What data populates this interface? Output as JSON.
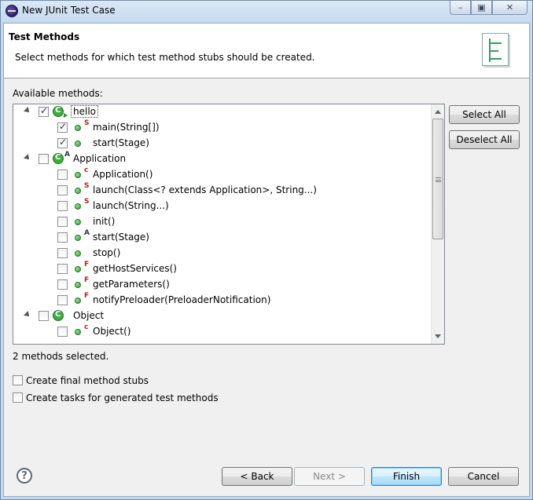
{
  "window": {
    "title": "New JUnit Test Case"
  },
  "header": {
    "title": "Test Methods",
    "description": "Select methods for which test method stubs should be created."
  },
  "available_label": "Available methods:",
  "tree": [
    {
      "label": "hello",
      "kind": "class",
      "checked": true,
      "run_badge": true
    },
    {
      "label": "main(String[])",
      "kind": "method",
      "modifier": "S",
      "checked": true
    },
    {
      "label": "start(Stage)",
      "kind": "method",
      "modifier": "",
      "checked": true
    },
    {
      "label": "Application",
      "kind": "class",
      "modifier": "A",
      "checked": false
    },
    {
      "label": "Application()",
      "kind": "method",
      "modifier": "c",
      "checked": false
    },
    {
      "label": "launch(Class<? extends Application>, String...)",
      "kind": "method",
      "modifier": "S",
      "checked": false
    },
    {
      "label": "launch(String...)",
      "kind": "method",
      "modifier": "S",
      "checked": false
    },
    {
      "label": "init()",
      "kind": "method",
      "modifier": "",
      "checked": false
    },
    {
      "label": "start(Stage)",
      "kind": "method",
      "modifier": "A",
      "checked": false
    },
    {
      "label": "stop()",
      "kind": "method",
      "modifier": "",
      "checked": false
    },
    {
      "label": "getHostServices()",
      "kind": "method",
      "modifier": "F",
      "checked": false
    },
    {
      "label": "getParameters()",
      "kind": "method",
      "modifier": "F",
      "checked": false
    },
    {
      "label": "notifyPreloader(PreloaderNotification)",
      "kind": "method",
      "modifier": "F",
      "checked": false
    },
    {
      "label": "Object",
      "kind": "class",
      "modifier": "",
      "checked": false
    },
    {
      "label": "Object()",
      "kind": "method",
      "modifier": "c",
      "checked": false
    }
  ],
  "buttons": {
    "select_all": "Select All",
    "deselect_all": "Deselect All",
    "back": "< Back",
    "next": "Next >",
    "finish": "Finish",
    "cancel": "Cancel"
  },
  "status": "2 methods selected.",
  "options": {
    "final_stubs": "Create final method stubs",
    "create_tasks": "Create tasks for generated test methods"
  },
  "colors": {
    "accent": "#3c7fb1",
    "method_green": "#2b9a2b",
    "static_red": "#b22222"
  }
}
